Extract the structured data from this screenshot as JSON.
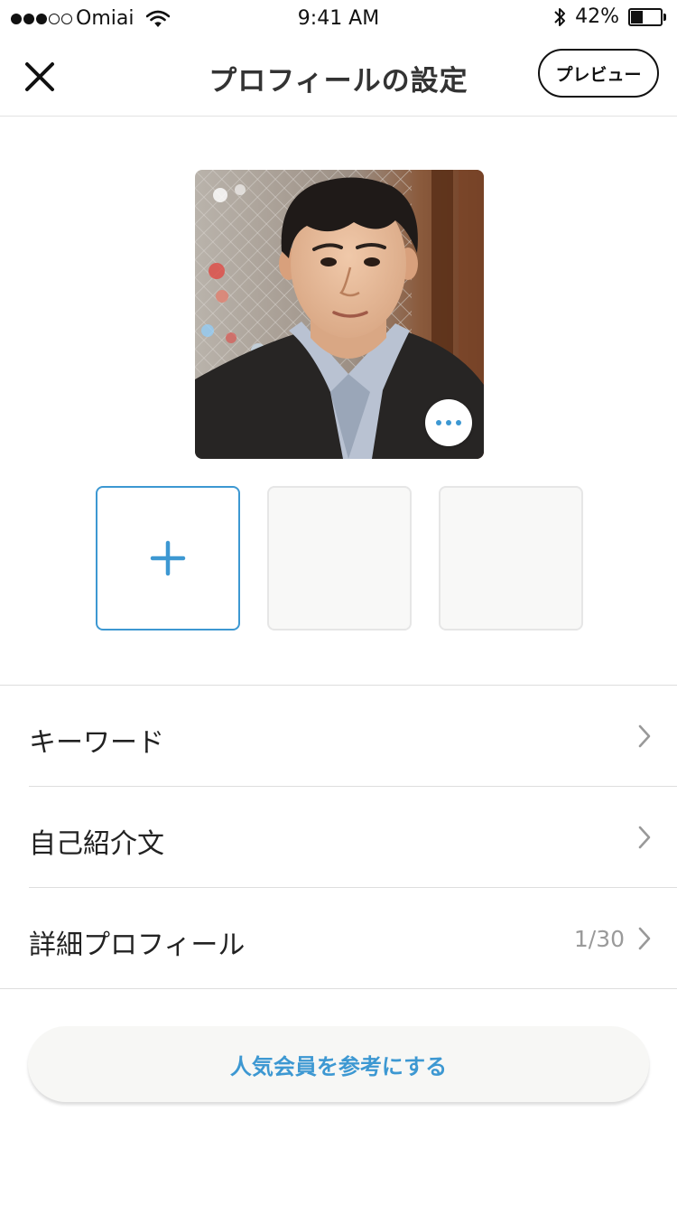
{
  "status_bar": {
    "carrier": "Omiai",
    "time": "9:41 AM",
    "battery_percent": "42%",
    "battery_level": 0.42,
    "signal_bars_filled": 3,
    "signal_bars_total": 5
  },
  "nav": {
    "title": "プロフィールの設定",
    "preview_label": "プレビュー",
    "close_icon": "close-icon"
  },
  "photos": {
    "main_photo_icon": "more-icon",
    "add_slot_icon": "plus-icon",
    "accent_color": "#3d98d2"
  },
  "menu": {
    "items": [
      {
        "label": "キーワード",
        "value": ""
      },
      {
        "label": "自己紹介文",
        "value": ""
      },
      {
        "label": "詳細プロフィール",
        "value": "1/30"
      }
    ]
  },
  "bottom_button": {
    "label": "人気会員を参考にする"
  }
}
